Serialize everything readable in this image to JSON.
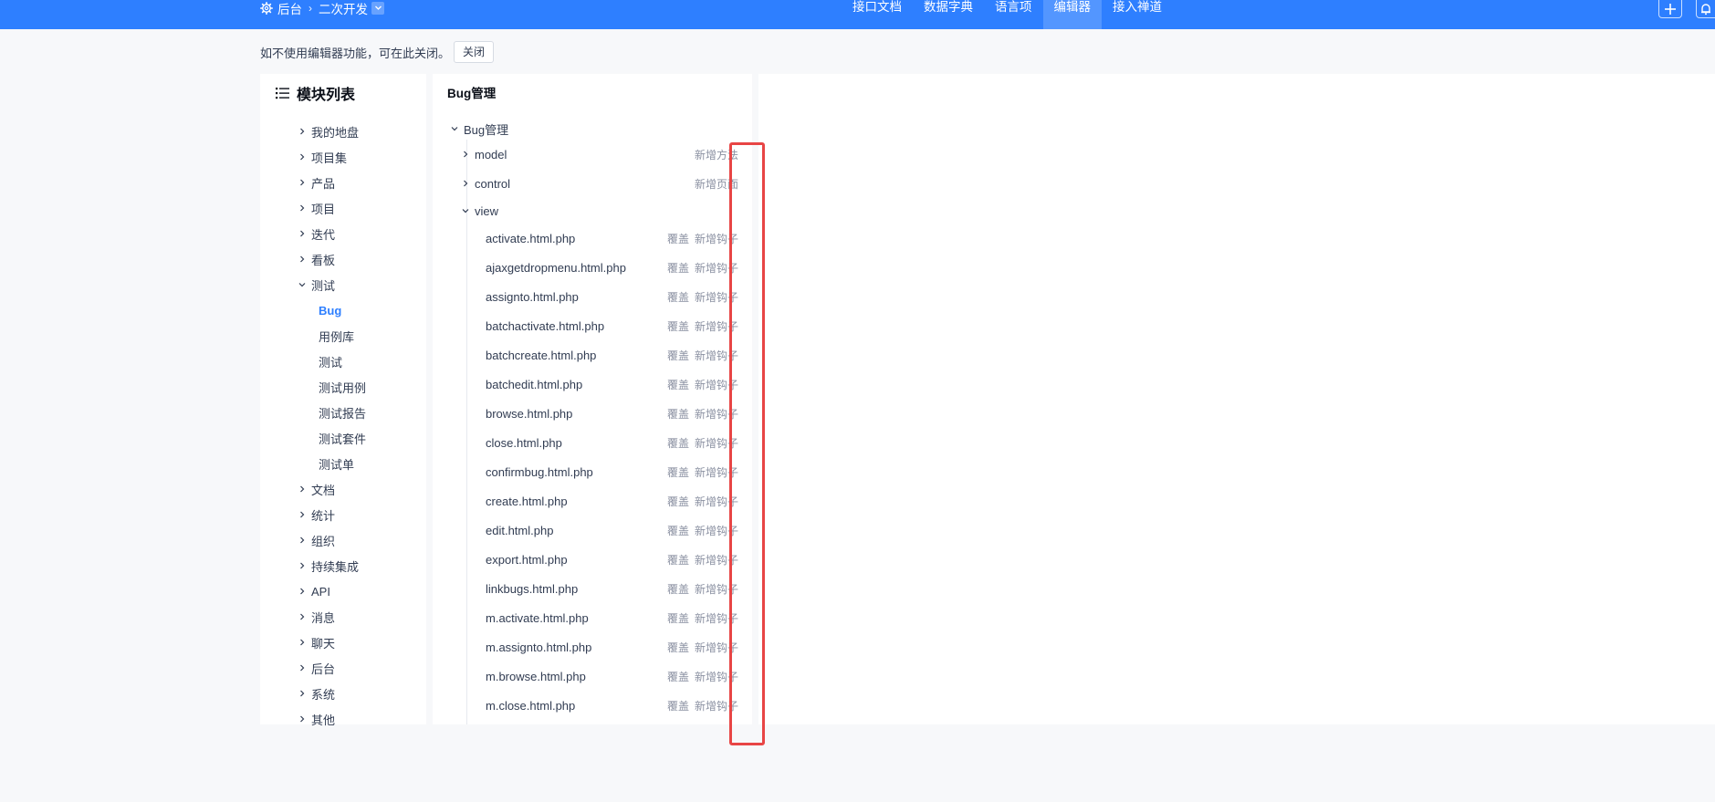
{
  "header": {
    "breadcrumb": {
      "root": "后台",
      "current": "二次开发"
    },
    "tabs": [
      {
        "label": "接口文档",
        "active": false
      },
      {
        "label": "数据字典",
        "active": false
      },
      {
        "label": "语言项",
        "active": false
      },
      {
        "label": "编辑器",
        "active": true
      },
      {
        "label": "接入禅道",
        "active": false
      }
    ]
  },
  "notice": {
    "text": "如不使用编辑器功能，可在此关闭。",
    "close_label": "关闭"
  },
  "left_panel": {
    "title": "模块列表",
    "items_before": [
      "我的地盘",
      "项目集",
      "产品",
      "项目",
      "迭代",
      "看板"
    ],
    "expanded": "测试",
    "sub_items": [
      "Bug",
      "用例库",
      "测试",
      "测试用例",
      "测试报告",
      "测试套件",
      "测试单"
    ],
    "active_sub": "Bug",
    "items_after": [
      "文档",
      "统计",
      "组织",
      "持续集成",
      "API",
      "消息",
      "聊天",
      "后台",
      "系统",
      "其他"
    ]
  },
  "mid_panel": {
    "title": "Bug管理",
    "root": "Bug管理",
    "nodes": [
      {
        "label": "model",
        "action": "新增方法"
      },
      {
        "label": "control",
        "action": "新增页面"
      },
      {
        "label": "view",
        "action": ""
      }
    ],
    "override_label": "覆盖",
    "hook_label": "新增钩子",
    "files": [
      "activate.html.php",
      "ajaxgetdropmenu.html.php",
      "assignto.html.php",
      "batchactivate.html.php",
      "batchcreate.html.php",
      "batchedit.html.php",
      "browse.html.php",
      "close.html.php",
      "confirmbug.html.php",
      "create.html.php",
      "edit.html.php",
      "export.html.php",
      "linkbugs.html.php",
      "m.activate.html.php",
      "m.assignto.html.php",
      "m.browse.html.php",
      "m.close.html.php"
    ]
  },
  "colors": {
    "brand": "#2e7fff",
    "highlight": "#e84545"
  }
}
